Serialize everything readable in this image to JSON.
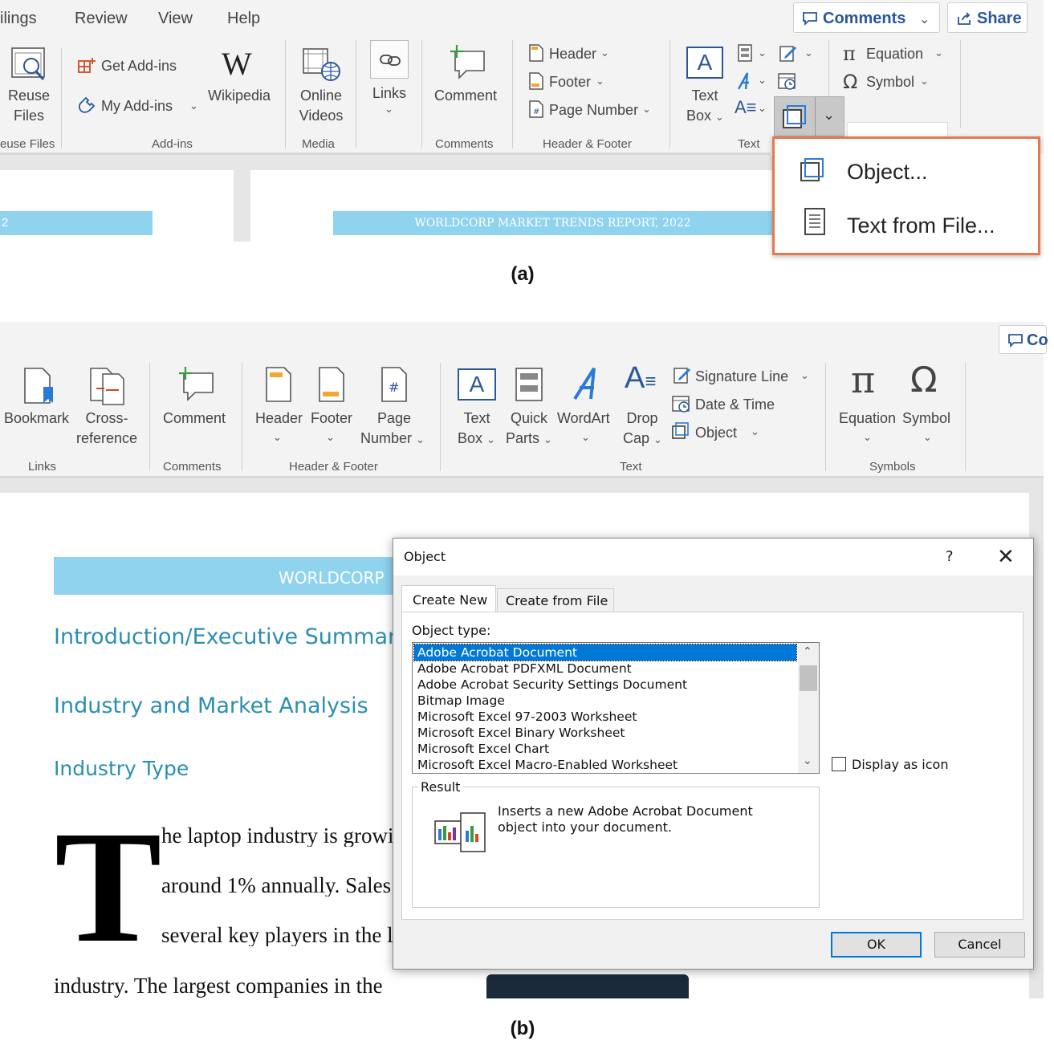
{
  "panel_a": {
    "caption": "(a)",
    "menu": [
      "ilings",
      "Review",
      "View",
      "Help"
    ],
    "comments_button": "Comments",
    "share_button": "Share",
    "reuse": {
      "line1": "Reuse",
      "line2": "Files",
      "group": "euse Files"
    },
    "addins": {
      "get": "Get Add-ins",
      "my": "My Add-ins",
      "wikipedia": "Wikipedia",
      "group": "Add-ins"
    },
    "media": {
      "line1": "Online",
      "line2": "Videos",
      "group": "Media"
    },
    "links": {
      "label": "Links"
    },
    "comments": {
      "label": "Comment",
      "group": "Comments"
    },
    "header_footer": {
      "header": "Header",
      "footer": "Footer",
      "page_number": "Page Number",
      "group": "Header & Footer"
    },
    "text": {
      "line1": "Text",
      "line2": "Box",
      "group": "Text"
    },
    "symbols": {
      "equation": "Equation",
      "symbol": "Symbol"
    },
    "dropdown": {
      "object": "Object...",
      "text_from_file": "Text from File..."
    },
    "doc_banner_left": "2",
    "doc_banner": "WORLDCORP MARKET TRENDS REPORT, 2022",
    "highlight_color": "#e8784e"
  },
  "panel_b": {
    "caption": "(b)",
    "comments_partial": "Co",
    "links_group": {
      "bookmark": "Bookmark",
      "cross1": "Cross-",
      "cross2": "reference",
      "group": "Links"
    },
    "comments_group": {
      "comment": "Comment",
      "group": "Comments"
    },
    "hf_group": {
      "header": "Header",
      "footer": "Footer",
      "page1": "Page",
      "page2": "Number",
      "group": "Header & Footer"
    },
    "text_group": {
      "textbox1": "Text",
      "textbox2": "Box",
      "quick1": "Quick",
      "quick2": "Parts",
      "wordart": "WordArt",
      "drop1": "Drop",
      "drop2": "Cap",
      "signature": "Signature Line",
      "datetime": "Date & Time",
      "object": "Object",
      "group": "Text"
    },
    "symbols_group": {
      "equation": "Equation",
      "symbol": "Symbol",
      "group": "Symbols"
    },
    "document": {
      "banner": "WORLDCORP",
      "h1": "Introduction/Executive Summary",
      "h2": "Industry and Market Analysis",
      "h3": "Industry Type",
      "dropcap": "T",
      "line1": "he laptop industry is growi",
      "line2": "around 1% annually.  Sales",
      "line3": "several key players in the l",
      "line4": "industry.  The largest companies in the"
    },
    "dialog": {
      "title": "Object",
      "help": "?",
      "tab_create_new": "Create New",
      "tab_create_from_file": "Create from File",
      "object_type_label": "Object type:",
      "object_types": [
        "Adobe Acrobat Document",
        "Adobe Acrobat PDFXML Document",
        "Adobe Acrobat Security Settings Document",
        "Bitmap Image",
        "Microsoft Excel 97-2003 Worksheet",
        "Microsoft Excel Binary Worksheet",
        "Microsoft Excel Chart",
        "Microsoft Excel Macro-Enabled Worksheet"
      ],
      "selected_index": 0,
      "display_as_icon": "Display as icon",
      "display_as_icon_checked": false,
      "result_label": "Result",
      "result_line1": "Inserts a new Adobe Acrobat Document",
      "result_line2": "object into your document.",
      "ok": "OK",
      "cancel": "Cancel"
    },
    "accent_color": "#2a8fb0",
    "banner_color": "#8fd3ef"
  }
}
